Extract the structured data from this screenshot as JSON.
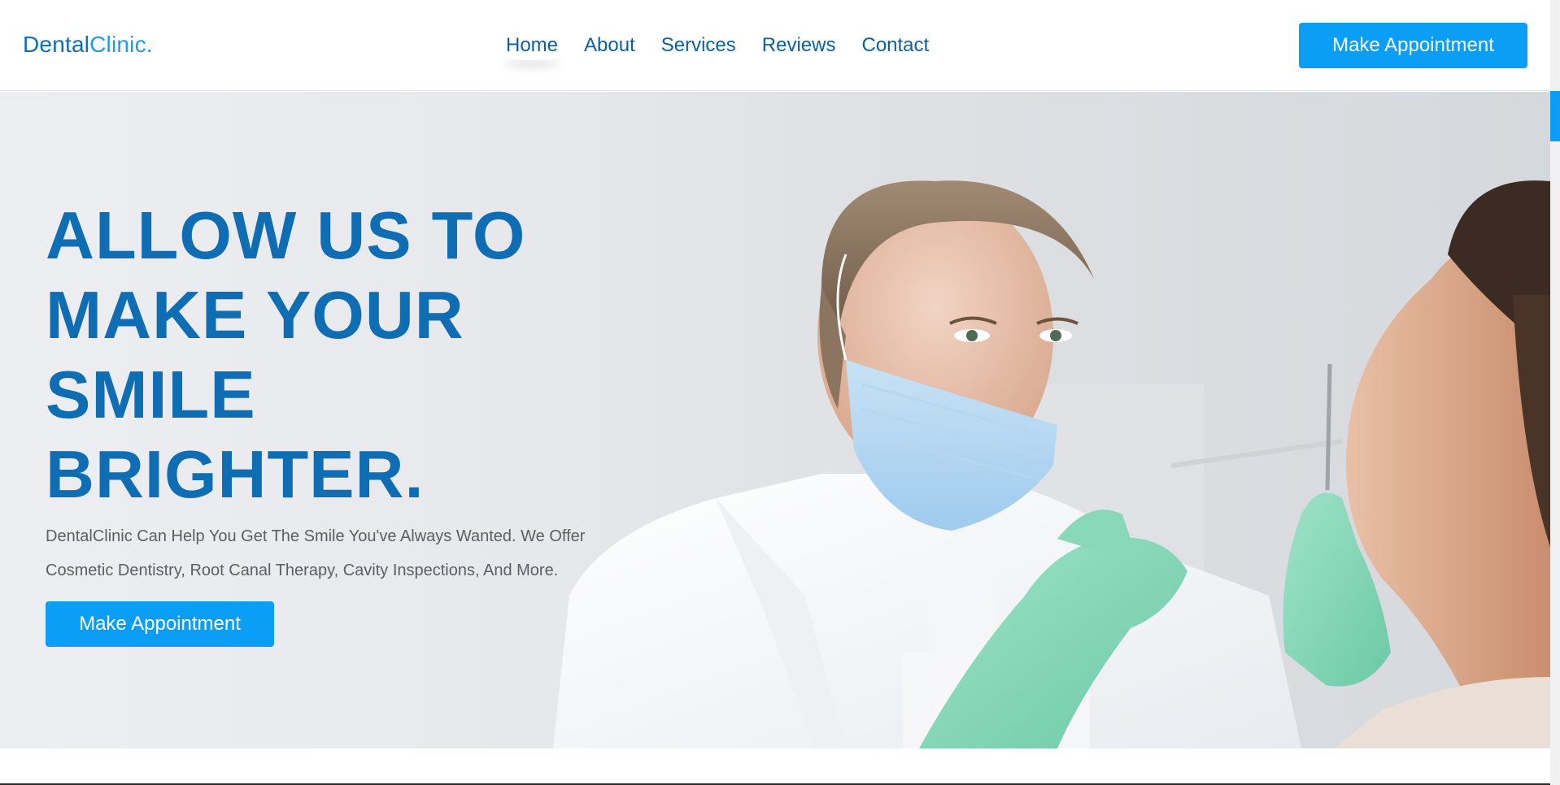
{
  "brand": {
    "name_part1": "Dental",
    "name_part2": "Clinic."
  },
  "nav": {
    "items": [
      {
        "label": "Home",
        "active": true
      },
      {
        "label": "About",
        "active": false
      },
      {
        "label": "Services",
        "active": false
      },
      {
        "label": "Reviews",
        "active": false
      },
      {
        "label": "Contact",
        "active": false
      }
    ]
  },
  "header": {
    "cta_label": "Make Appointment"
  },
  "hero": {
    "title_lines": [
      "ALLOW US TO",
      "MAKE YOUR",
      "SMILE",
      "BRIGHTER."
    ],
    "description": "DentalClinic Can Help You Get The Smile You've Always Wanted. We Offer Cosmetic Dentistry, Root Canal Therapy, Cavity Inspections, And More.",
    "cta_label": "Make Appointment",
    "image_icon": "dentist-photo"
  },
  "colors": {
    "brand_dark": "#0f6db4",
    "brand_light": "#1e9bf0",
    "accent_button": "#0a9ef7",
    "body_text": "#5a5f66"
  }
}
